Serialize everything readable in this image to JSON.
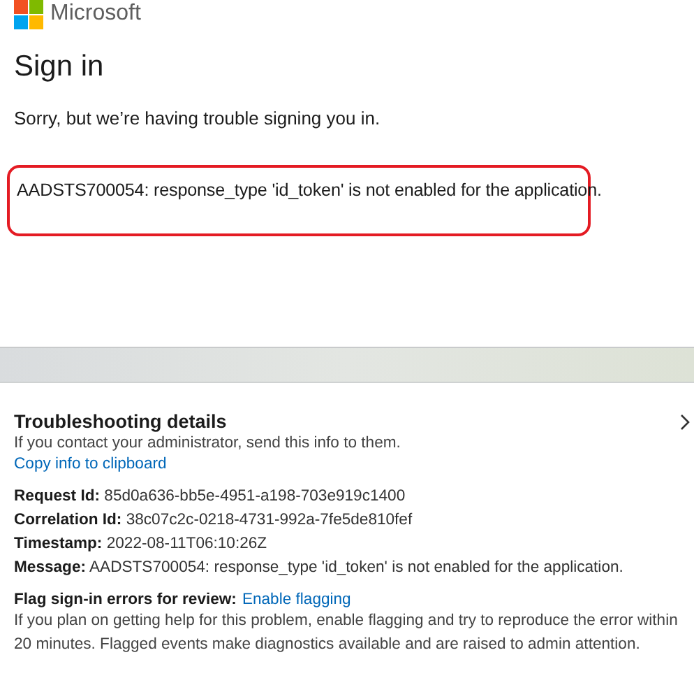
{
  "brand": {
    "name": "Microsoft"
  },
  "title": "Sign in",
  "intro": "Sorry, but we’re having trouble signing you in.",
  "error": {
    "text": "AADSTS700054: response_type 'id_token' is not enabled for the application.",
    "highlighted": true
  },
  "troubleshooting": {
    "title": "Troubleshooting details",
    "expanded": false,
    "hint": "If you contact your administrator, send this info to them.",
    "copy_link": "Copy info to clipboard",
    "details": [
      {
        "label": "Request Id:",
        "value": "85d0a636-bb5e-4951-a198-703e919c1400"
      },
      {
        "label": "Correlation Id:",
        "value": "38c07c2c-0218-4731-992a-7fe5de810fef"
      },
      {
        "label": "Timestamp:",
        "value": "2022-08-11T06:10:26Z"
      },
      {
        "label": "Message:",
        "value": "AADSTS700054: response_type 'id_token' is not enabled for the application."
      }
    ],
    "flag": {
      "label": "Flag sign-in errors for review:",
      "link": "Enable flagging",
      "note": "If you plan on getting help for this problem, enable flagging and try to reproduce the error within 20 minutes. Flagged events make diagnostics available and are raised to admin attention."
    }
  }
}
